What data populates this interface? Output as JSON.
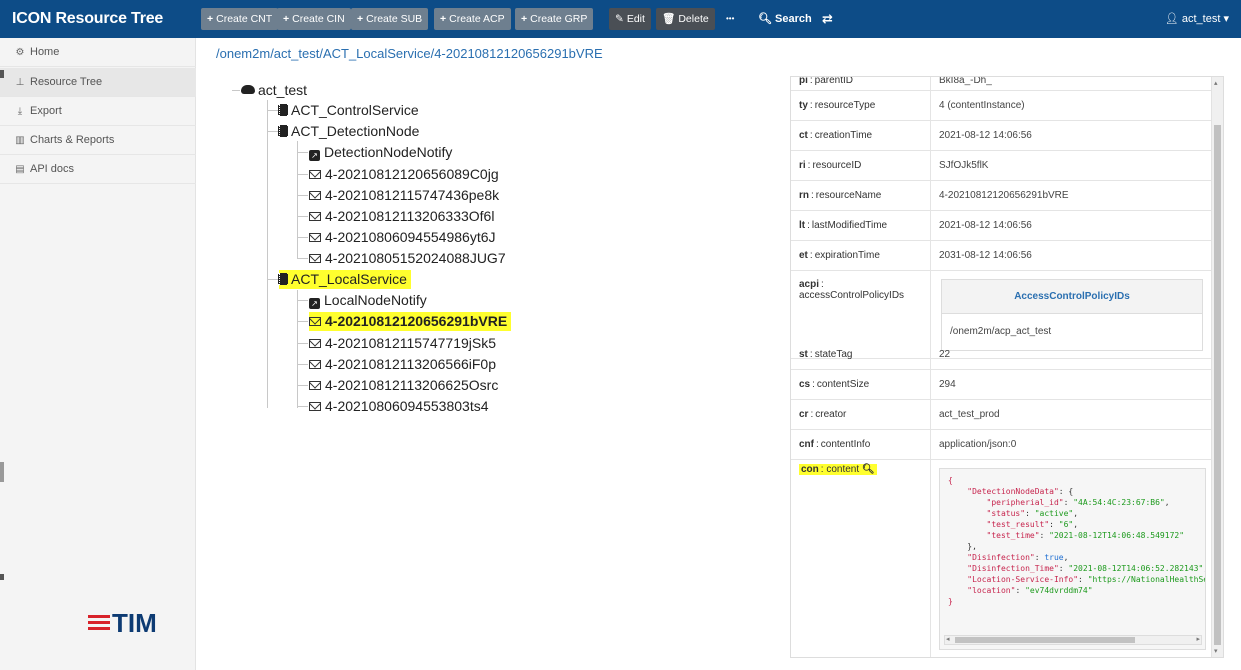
{
  "app": {
    "title": "ICON Resource Tree"
  },
  "toolbar": {
    "create_cnt": "Create CNT",
    "create_cin": "Create CIN",
    "create_sub": "Create SUB",
    "create_acp": "Create ACP",
    "create_grp": "Create GRP",
    "edit": "Edit",
    "delete": "Delete",
    "more": "•••",
    "search": "Search",
    "swap": "⇄",
    "user": "act_test"
  },
  "sidebar": {
    "items": [
      {
        "label": "Home",
        "icon": "dashboard-icon"
      },
      {
        "label": "Resource Tree",
        "icon": "sitemap-icon"
      },
      {
        "label": "Export",
        "icon": "download-icon"
      },
      {
        "label": "Charts & Reports",
        "icon": "bar-chart-icon"
      },
      {
        "label": "API docs",
        "icon": "document-icon"
      }
    ],
    "logo_text": "TIM"
  },
  "breadcrumb": "/onem2m/act_test/ACT_LocalService/4-20210812120656291bVRE",
  "tree": {
    "root": "act_test",
    "control_service": "ACT_ControlService",
    "detection_node": "ACT_DetectionNode",
    "detection_children": [
      "DetectionNodeNotify",
      "4-20210812120656089C0jg",
      "4-20210812115747436pe8k",
      "4-20210812113206333Of6l",
      "4-20210806094554986yt6J",
      "4-20210805152024088JUG7"
    ],
    "local_service": "ACT_LocalService",
    "local_children": [
      "LocalNodeNotify",
      "4-20210812120656291bVRE",
      "4-20210812115747719jSk5",
      "4-20210812113206566iF0p",
      "4-20210812113206625Osrc",
      "4-20210806094553803ts4"
    ]
  },
  "details": {
    "partial_row": {
      "abbr": "pi",
      "key": "parentID",
      "value": "BkI8a_-Dh_"
    },
    "rows": [
      {
        "abbr": "ty",
        "key": "resourceType",
        "value": "4 (contentInstance)"
      },
      {
        "abbr": "ct",
        "key": "creationTime",
        "value": "2021-08-12 14:06:56"
      },
      {
        "abbr": "ri",
        "key": "resourceID",
        "value": "SJfOJk5flK"
      },
      {
        "abbr": "rn",
        "key": "resourceName",
        "value": "4-20210812120656291bVRE"
      },
      {
        "abbr": "lt",
        "key": "lastModifiedTime",
        "value": "2021-08-12 14:06:56"
      },
      {
        "abbr": "et",
        "key": "expirationTime",
        "value": "2031-08-12 14:06:56"
      }
    ],
    "acpi": {
      "abbr": "acpi",
      "key": "accessControlPolicyIDs",
      "header": "AccessControlPolicyIDs",
      "value": "/onem2m/acp_act_test"
    },
    "rows2": [
      {
        "abbr": "st",
        "key": "stateTag",
        "value": "22"
      },
      {
        "abbr": "cs",
        "key": "contentSize",
        "value": "294"
      },
      {
        "abbr": "cr",
        "key": "creator",
        "value": "act_test_prod"
      },
      {
        "abbr": "cnf",
        "key": "contentInfo",
        "value": "application/json:0"
      }
    ],
    "con": {
      "abbr": "con",
      "key": "content",
      "json": {
        "open": "{",
        "dnd_key": "\"DetectionNodeData\"",
        "peripheral_key": "\"peripherial_id\"",
        "peripheral_val": "\"4A:54:4C:23:67:B6\"",
        "status_key": "\"status\"",
        "status_val": "\"active\"",
        "test_result_key": "\"test_result\"",
        "test_result_val": "\"6\"",
        "test_time_key": "\"test_time\"",
        "test_time_val": "\"2021-08-12T14:06:48.549172\"",
        "inner_close": "},",
        "disinfection_key": "\"Disinfection\"",
        "disinfection_val": "true",
        "disinfection_time_key": "\"Disinfection_Time\"",
        "disinfection_time_val": "\"2021-08-12T14:06:52.282143\"",
        "location_info_key": "\"Location-Service-Info\"",
        "location_info_val": "\"https://NationalHealthService\"",
        "location_key": "\"location\"",
        "location_val": "\"ev74dvrddm74\"",
        "close": "}"
      }
    }
  },
  "colors": {
    "navbar": "#0d4c87",
    "highlight": "#ffff2e",
    "link": "#2a6fb0"
  }
}
